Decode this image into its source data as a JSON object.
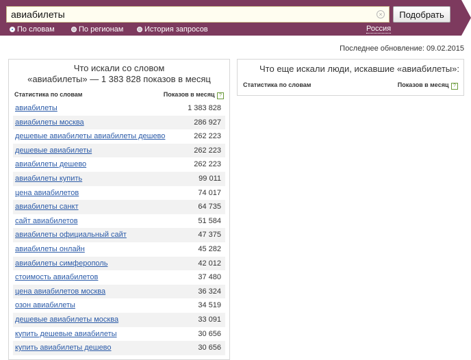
{
  "search": {
    "query": "авиабилеты",
    "submit_label": "Подобрать",
    "clear_glyph": "×"
  },
  "modes": [
    {
      "label": "По словам",
      "checked": true
    },
    {
      "label": "По регионам",
      "checked": false
    },
    {
      "label": "История запросов",
      "checked": false
    }
  ],
  "region": "Россия",
  "last_update": "Последнее обновление: 09.02.2015",
  "left_panel": {
    "title_line1": "Что искали со словом",
    "title_line2": "«авиабилеты» — 1 383 828 показов в месяц",
    "col_words": "Статистика по словам",
    "col_count": "Показов в месяц",
    "rows": [
      {
        "keyword": "авиабилеты",
        "count": "1 383 828"
      },
      {
        "keyword": "авиабилеты москва",
        "count": "286 927"
      },
      {
        "keyword": "дешевые авиабилеты авиабилеты дешево",
        "count": "262 223"
      },
      {
        "keyword": "дешевые авиабилеты",
        "count": "262 223"
      },
      {
        "keyword": "авиабилеты дешево",
        "count": "262 223"
      },
      {
        "keyword": "авиабилеты купить",
        "count": "99 011"
      },
      {
        "keyword": "цена авиабилетов",
        "count": "74 017"
      },
      {
        "keyword": "авиабилеты санкт",
        "count": "64 735"
      },
      {
        "keyword": "сайт авиабилетов",
        "count": "51 584"
      },
      {
        "keyword": "авиабилеты официальный сайт",
        "count": "47 375"
      },
      {
        "keyword": "авиабилеты онлайн",
        "count": "45 282"
      },
      {
        "keyword": "авиабилеты симферополь",
        "count": "42 012"
      },
      {
        "keyword": "стоимость авиабилетов",
        "count": "37 480"
      },
      {
        "keyword": "цена авиабилетов москва",
        "count": "36 324"
      },
      {
        "keyword": "озон авиабилеты",
        "count": "34 519"
      },
      {
        "keyword": "дешевые авиабилеты москва",
        "count": "33 091"
      },
      {
        "keyword": "купить дешевые авиабилеты",
        "count": "30 656"
      },
      {
        "keyword": "купить авиабилеты дешево",
        "count": "30 656"
      }
    ]
  },
  "right_panel": {
    "title": "Что еще искали люди, искавшие «авиабилеты»:",
    "col_words": "Статистика по словам",
    "col_count": "Показов в месяц"
  },
  "help_glyph": "?",
  "colors": {
    "bar": "#7d3a5e",
    "link": "#2a5aa8",
    "row_alt": "#f2f2f2"
  }
}
